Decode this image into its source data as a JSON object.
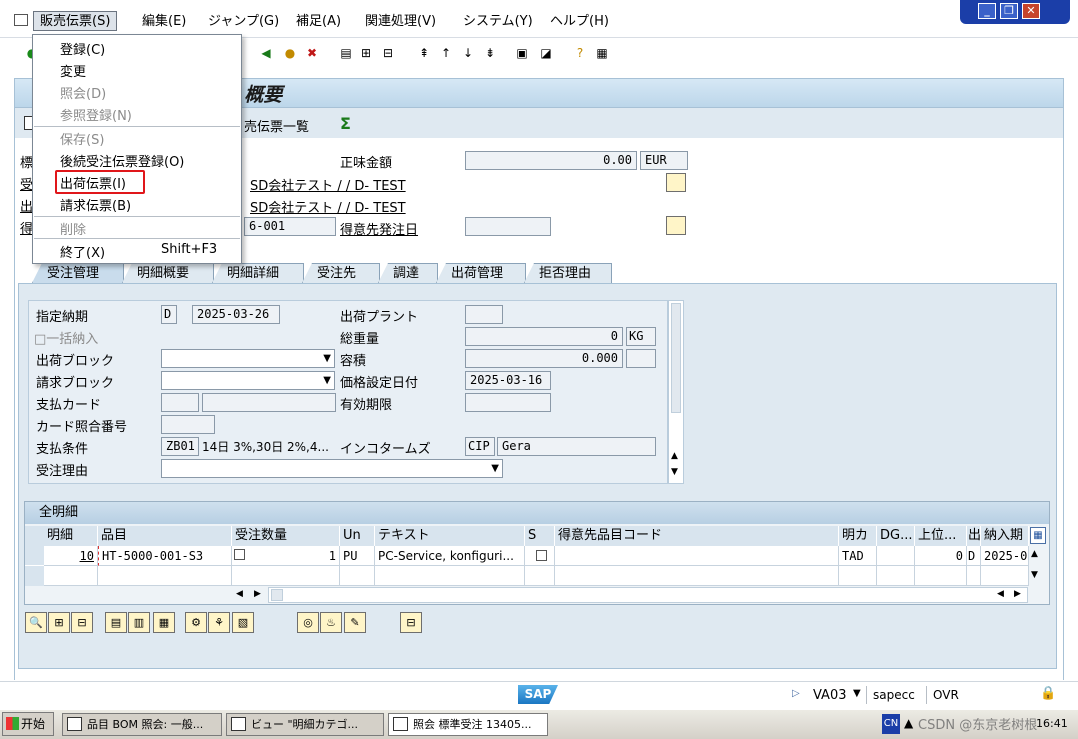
{
  "menubar": {
    "items": [
      "販売伝票(S)",
      "編集(E)",
      "ジャンプ(G)",
      "補足(A)",
      "関連処理(V)",
      "システム(Y)",
      "ヘルプ(H)"
    ]
  },
  "dropdown": {
    "items": [
      {
        "label": "登録(C)",
        "disabled": false
      },
      {
        "label": "変更",
        "disabled": false
      },
      {
        "label": "照会(D)",
        "disabled": true
      },
      {
        "label": "参照登録(N)",
        "disabled": true
      },
      {
        "label": "保存(S)",
        "disabled": true
      },
      {
        "label": "後続受注伝票登録(O)",
        "disabled": false
      },
      {
        "label": "出荷伝票(I)",
        "disabled": false
      },
      {
        "label": "請求伝票(B)",
        "disabled": false
      },
      {
        "label": "削除",
        "disabled": true
      },
      {
        "label": "終了(X)",
        "disabled": false
      }
    ],
    "shortcut": "Shift+F3"
  },
  "title": {
    "text": ": 概要"
  },
  "apptoolbar": {
    "label": "売伝票一覧"
  },
  "header": {
    "row_labels": [
      "標",
      "受",
      "出",
      "得"
    ],
    "net_value_label": "正味金額",
    "net_value": "0.00",
    "currency": "EUR",
    "sold_to": "SD会社テスト / / D- TEST",
    "ship_to": "SD会社テスト / / D- TEST",
    "po_suffix": "6-001",
    "po_date_label": "得意先発注日"
  },
  "tabs": [
    "受注管理",
    "明細概要",
    "明細詳細",
    "受注先",
    "調達",
    "出荷管理",
    "拒否理由"
  ],
  "form": {
    "req_delivery_label": "指定納期",
    "req_delivery_type": "D",
    "req_delivery_date": "2025-03-26",
    "complete_delivery_label": "□一括納入",
    "delivery_block_label": "出荷ブロック",
    "billing_block_label": "請求ブロック",
    "payment_card_label": "支払カード",
    "card_verif_label": "カード照合番号",
    "payment_terms_label": "支払条件",
    "payment_terms_code": "ZB01",
    "payment_terms_text": "14日 3%,30日 2%,4...",
    "order_reason_label": "受注理由",
    "delivery_plant_label": "出荷プラント",
    "total_weight_label": "総重量",
    "total_weight": "0",
    "weight_unit": "KG",
    "volume_label": "容積",
    "volume": "0.000",
    "pricing_date_label": "価格設定日付",
    "pricing_date": "2025-03-16",
    "valid_to_label": "有効期限",
    "incoterms_label": "インコタームズ",
    "incoterms_code": "CIP",
    "incoterms_text": "Gera"
  },
  "table": {
    "title": "全明細",
    "columns": [
      "明細",
      "品目",
      "受注数量",
      "Un",
      "テキスト",
      "S",
      "得意先品目コード",
      "明カ",
      "DG...",
      "上位...",
      "出",
      "納入期"
    ],
    "rows": [
      {
        "item": "10",
        "material": "HT-5000-001-S3",
        "qty": "1",
        "unit": "PU",
        "text": "PC-Service, konfiguri...",
        "higher": "0",
        "ship": "D",
        "delivery": "2025-0",
        "cat": "TAD"
      }
    ]
  },
  "status": {
    "tcode": "VA03",
    "server": "sapecc",
    "mode": "OVR"
  },
  "taskbar": {
    "start": "开始",
    "tasks": [
      "品目 BOM 照会: 一般...",
      "ビュー \"明細カテゴ...",
      "照会 標準受注 13405..."
    ],
    "watermark": "CSDN @东京老树根",
    "tray_time": "16:41"
  }
}
